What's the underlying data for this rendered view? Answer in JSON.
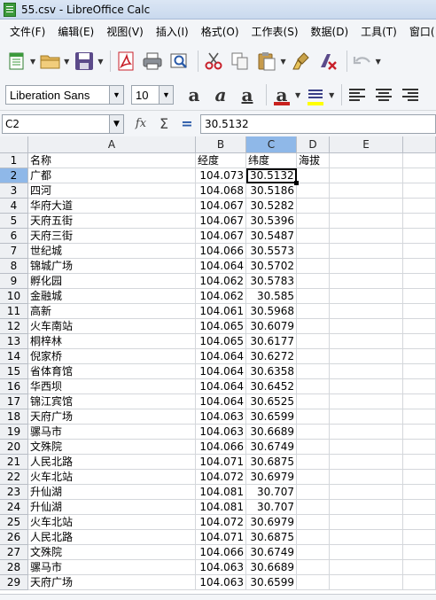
{
  "window": {
    "title": "55.csv - LibreOffice Calc"
  },
  "menu": [
    "文件(F)",
    "编辑(E)",
    "视图(V)",
    "插入(I)",
    "格式(O)",
    "工作表(S)",
    "数据(D)",
    "工具(T)",
    "窗口("
  ],
  "toolbar2": {
    "font_name": "Liberation Sans",
    "font_size": "10"
  },
  "formula": {
    "cell_ref": "C2",
    "value": "30.5132"
  },
  "colors": {
    "font_color": "#c9211e",
    "highlight_color": "#ffff00",
    "selection": "#8fb8e8"
  },
  "columns": [
    "A",
    "B",
    "C",
    "D",
    "E"
  ],
  "rows": [
    {
      "n": "1",
      "a": "名称",
      "b": "经度",
      "c": "纬度",
      "d": "海拔"
    },
    {
      "n": "2",
      "a": "广都",
      "b": "104.073",
      "c": "30.5132",
      "d": ""
    },
    {
      "n": "3",
      "a": "四河",
      "b": "104.068",
      "c": "30.5186",
      "d": ""
    },
    {
      "n": "4",
      "a": "华府大道",
      "b": "104.067",
      "c": "30.5282",
      "d": ""
    },
    {
      "n": "5",
      "a": "天府五街",
      "b": "104.067",
      "c": "30.5396",
      "d": ""
    },
    {
      "n": "6",
      "a": "天府三街",
      "b": "104.067",
      "c": "30.5487",
      "d": ""
    },
    {
      "n": "7",
      "a": "世纪城",
      "b": "104.066",
      "c": "30.5573",
      "d": ""
    },
    {
      "n": "8",
      "a": "锦城广场",
      "b": "104.064",
      "c": "30.5702",
      "d": ""
    },
    {
      "n": "9",
      "a": "孵化园",
      "b": "104.062",
      "c": "30.5783",
      "d": ""
    },
    {
      "n": "10",
      "a": "金融城",
      "b": "104.062",
      "c": "30.585",
      "d": ""
    },
    {
      "n": "11",
      "a": "高新",
      "b": "104.061",
      "c": "30.5968",
      "d": ""
    },
    {
      "n": "12",
      "a": "火车南站",
      "b": "104.065",
      "c": "30.6079",
      "d": ""
    },
    {
      "n": "13",
      "a": "桐梓林",
      "b": "104.065",
      "c": "30.6177",
      "d": ""
    },
    {
      "n": "14",
      "a": "倪家桥",
      "b": "104.064",
      "c": "30.6272",
      "d": ""
    },
    {
      "n": "15",
      "a": "省体育馆",
      "b": "104.064",
      "c": "30.6358",
      "d": ""
    },
    {
      "n": "16",
      "a": "华西坝",
      "b": "104.064",
      "c": "30.6452",
      "d": ""
    },
    {
      "n": "17",
      "a": "锦江宾馆",
      "b": "104.064",
      "c": "30.6525",
      "d": ""
    },
    {
      "n": "18",
      "a": "天府广场",
      "b": "104.063",
      "c": "30.6599",
      "d": ""
    },
    {
      "n": "19",
      "a": "骡马市",
      "b": "104.063",
      "c": "30.6689",
      "d": ""
    },
    {
      "n": "20",
      "a": "文殊院",
      "b": "104.066",
      "c": "30.6749",
      "d": ""
    },
    {
      "n": "21",
      "a": "人民北路",
      "b": "104.071",
      "c": "30.6875",
      "d": ""
    },
    {
      "n": "22",
      "a": "火车北站",
      "b": "104.072",
      "c": "30.6979",
      "d": ""
    },
    {
      "n": "23",
      "a": "升仙湖",
      "b": "104.081",
      "c": "30.707",
      "d": ""
    },
    {
      "n": "24",
      "a": "升仙湖",
      "b": "104.081",
      "c": "30.707",
      "d": ""
    },
    {
      "n": "25",
      "a": "火车北站",
      "b": "104.072",
      "c": "30.6979",
      "d": ""
    },
    {
      "n": "26",
      "a": "人民北路",
      "b": "104.071",
      "c": "30.6875",
      "d": ""
    },
    {
      "n": "27",
      "a": "文殊院",
      "b": "104.066",
      "c": "30.6749",
      "d": ""
    },
    {
      "n": "28",
      "a": "骡马市",
      "b": "104.063",
      "c": "30.6689",
      "d": ""
    },
    {
      "n": "29",
      "a": "天府广场",
      "b": "104.063",
      "c": "30.6599",
      "d": ""
    }
  ]
}
